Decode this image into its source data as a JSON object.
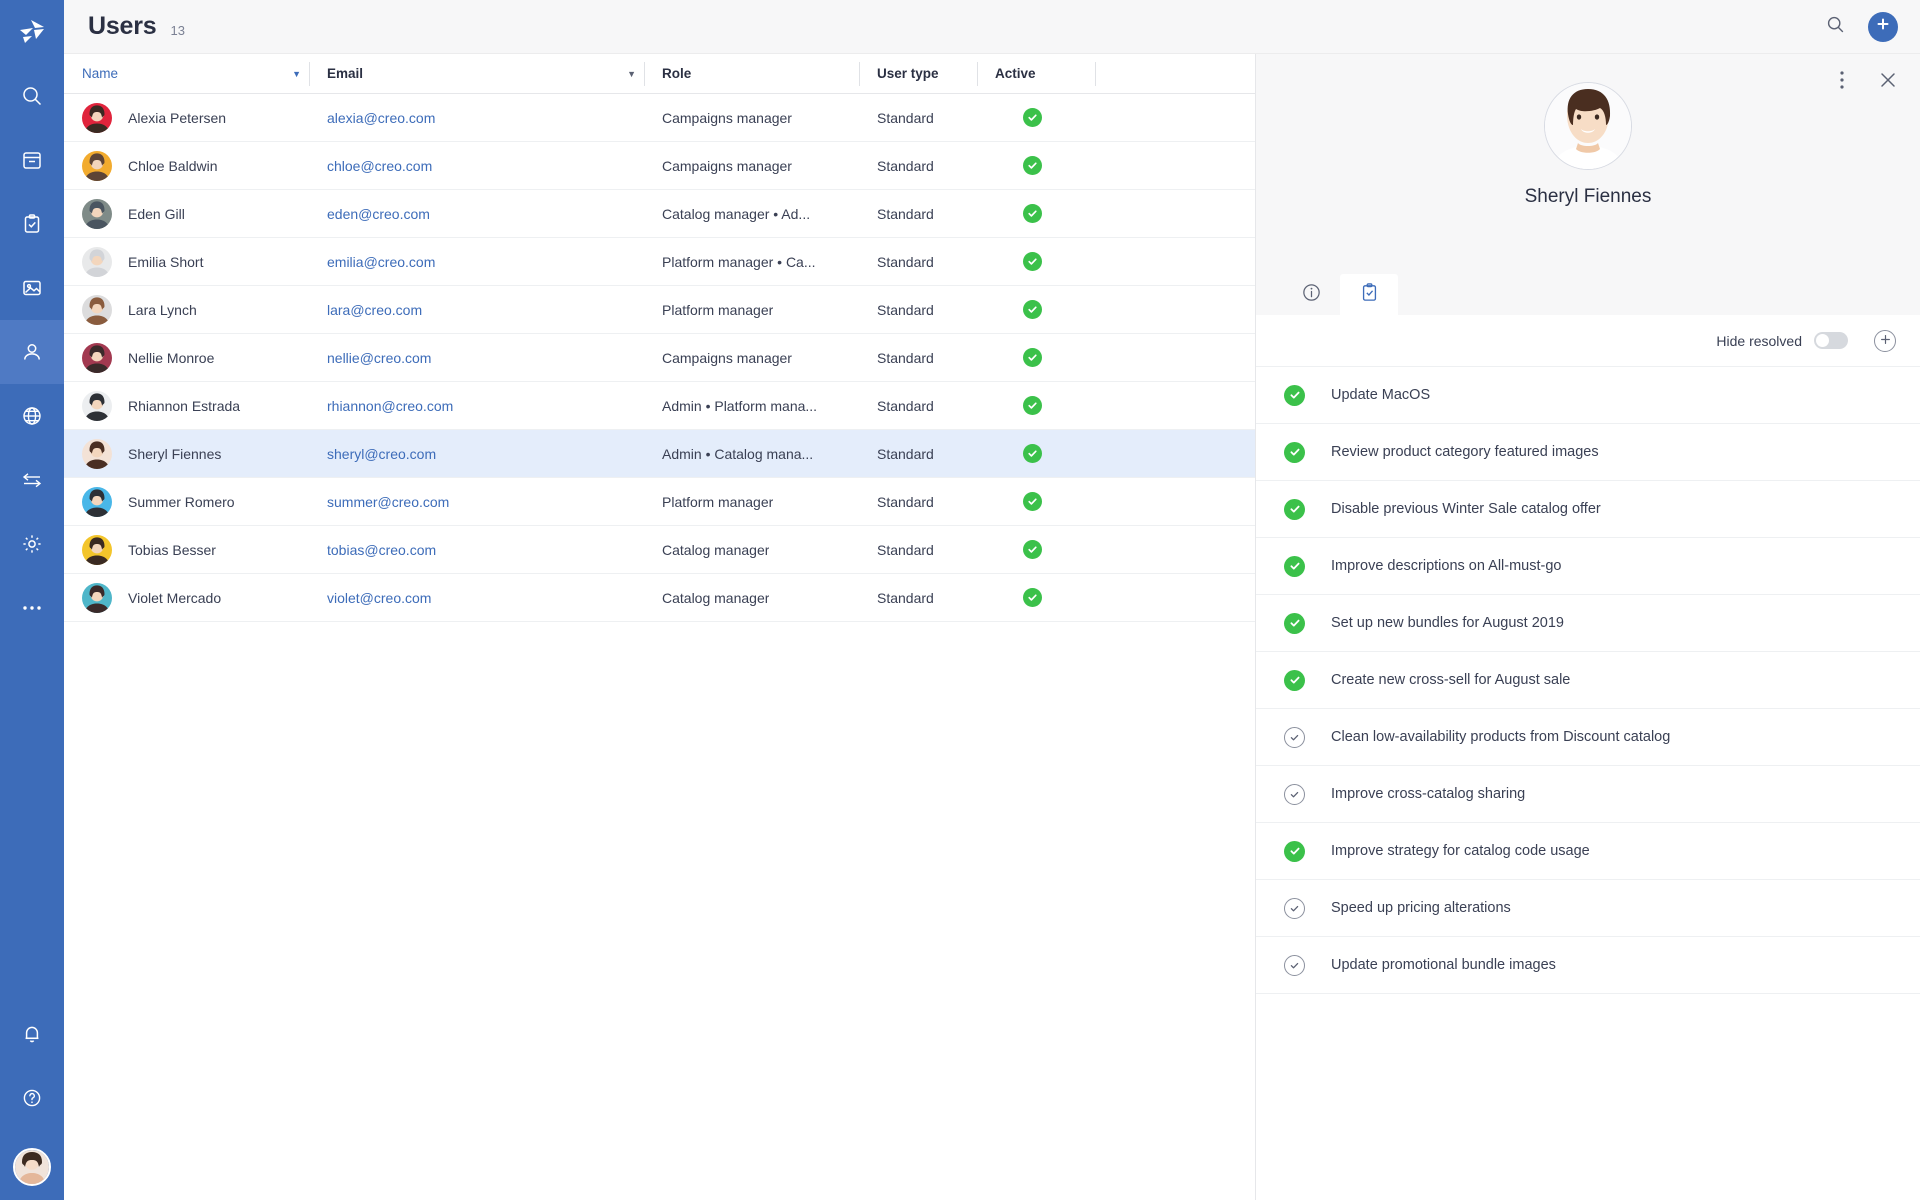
{
  "sidebar": {
    "logo_name": "creo-logo",
    "items": [
      {
        "name": "search-icon",
        "label": "Search",
        "active": false
      },
      {
        "name": "box-icon",
        "label": "Products",
        "active": false
      },
      {
        "name": "clipboard-check-icon",
        "label": "Tasks",
        "active": false
      },
      {
        "name": "image-icon",
        "label": "Media",
        "active": false
      },
      {
        "name": "user-icon",
        "label": "Users",
        "active": true
      },
      {
        "name": "globe-icon",
        "label": "Channels",
        "active": false
      },
      {
        "name": "transfer-arrows-icon",
        "label": "Imports",
        "active": false
      },
      {
        "name": "gear-icon",
        "label": "Settings",
        "active": false
      },
      {
        "name": "more-horizontal-icon",
        "label": "More",
        "active": false
      }
    ],
    "bottom_items": [
      {
        "name": "bell-icon",
        "label": "Notifications"
      },
      {
        "name": "help-circle-icon",
        "label": "Help"
      }
    ],
    "account_avatar_name": "account-avatar"
  },
  "header": {
    "title": "Users",
    "count": "13",
    "search_icon": "search-icon",
    "add_icon": "plus-icon"
  },
  "table": {
    "columns": [
      {
        "label": "Name",
        "sorted": true,
        "has_caret": true
      },
      {
        "label": "Email",
        "sorted": false,
        "has_caret": true
      },
      {
        "label": "Role",
        "sorted": false,
        "has_caret": false
      },
      {
        "label": "User type",
        "sorted": false,
        "has_caret": false
      },
      {
        "label": "Active",
        "sorted": false,
        "has_caret": false
      },
      {
        "label": "",
        "sorted": false,
        "has_caret": false
      }
    ],
    "rows": [
      {
        "name": "Alexia Petersen",
        "email": "alexia@creo.com",
        "role": "Campaigns manager",
        "user_type": "Standard",
        "active": true,
        "selected": false,
        "av1": "#e0243c",
        "av2": "#3a2a22"
      },
      {
        "name": "Chloe Baldwin",
        "email": "chloe@creo.com",
        "role": "Campaigns manager",
        "user_type": "Standard",
        "active": true,
        "selected": false,
        "av1": "#f2ab2e",
        "av2": "#5d4436"
      },
      {
        "name": "Eden Gill",
        "email": "eden@creo.com",
        "role": "Catalog manager • Ad...",
        "user_type": "Standard",
        "active": true,
        "selected": false,
        "av1": "#7f8b88",
        "av2": "#4a5560"
      },
      {
        "name": "Emilia Short",
        "email": "emilia@creo.com",
        "role": "Platform manager • Ca...",
        "user_type": "Standard",
        "active": true,
        "selected": false,
        "av1": "#e8e9ea",
        "av2": "#d2d4d8"
      },
      {
        "name": "Lara Lynch",
        "email": "lara@creo.com",
        "role": "Platform manager",
        "user_type": "Standard",
        "active": true,
        "selected": false,
        "av1": "#dcdcdd",
        "av2": "#8a5c3e"
      },
      {
        "name": "Nellie Monroe",
        "email": "nellie@creo.com",
        "role": "Campaigns manager",
        "user_type": "Standard",
        "active": true,
        "selected": false,
        "av1": "#a23950",
        "av2": "#3a2a2a"
      },
      {
        "name": "Rhiannon Estrada",
        "email": "rhiannon@creo.com",
        "role": "Admin • Platform mana...",
        "user_type": "Standard",
        "active": true,
        "selected": false,
        "av1": "#eceef0",
        "av2": "#2d3036"
      },
      {
        "name": "Sheryl Fiennes",
        "email": "sheryl@creo.com",
        "role": "Admin • Catalog mana...",
        "user_type": "Standard",
        "active": true,
        "selected": true,
        "av1": "#f3e2d6",
        "av2": "#4a2e22"
      },
      {
        "name": "Summer Romero",
        "email": "summer@creo.com",
        "role": "Platform manager",
        "user_type": "Standard",
        "active": true,
        "selected": false,
        "av1": "#49b7e8",
        "av2": "#2d3036"
      },
      {
        "name": "Tobias Besser",
        "email": "tobias@creo.com",
        "role": "Catalog manager",
        "user_type": "Standard",
        "active": true,
        "selected": false,
        "av1": "#f3c52b",
        "av2": "#3a2a22"
      },
      {
        "name": "Violet Mercado",
        "email": "violet@creo.com",
        "role": "Catalog manager",
        "user_type": "Standard",
        "active": true,
        "selected": false,
        "av1": "#4fb6c9",
        "av2": "#3a2a2a"
      }
    ]
  },
  "detail": {
    "kebab_icon": "more-vertical-icon",
    "close_icon": "close-icon",
    "avatar_name": "detail-avatar",
    "user_name": "Sheryl Fiennes",
    "tabs": [
      {
        "name": "tab-info",
        "icon": "info-circle-icon",
        "active": false
      },
      {
        "name": "tab-tasks",
        "icon": "clipboard-check-icon",
        "active": true
      }
    ],
    "toolbar": {
      "hide_resolved_label": "Hide resolved",
      "hide_resolved_on": false,
      "add_icon": "plus-icon"
    },
    "tasks": [
      {
        "label": "Update MacOS",
        "resolved": true
      },
      {
        "label": "Review product category featured images",
        "resolved": true
      },
      {
        "label": "Disable previous Winter Sale catalog offer",
        "resolved": true
      },
      {
        "label": "Improve descriptions on All-must-go",
        "resolved": true
      },
      {
        "label": "Set up new bundles for August 2019",
        "resolved": true
      },
      {
        "label": "Create new cross-sell for August sale",
        "resolved": true
      },
      {
        "label": "Clean low-availability products from Discount catalog",
        "resolved": false
      },
      {
        "label": "Improve cross-catalog sharing",
        "resolved": false
      },
      {
        "label": "Improve strategy for catalog code usage",
        "resolved": true
      },
      {
        "label": "Speed up pricing alterations",
        "resolved": false
      },
      {
        "label": "Update promotional bundle images",
        "resolved": false
      }
    ]
  },
  "colors": {
    "brand_blue": "#3d6cb9",
    "link_blue": "#3d6cb9",
    "success_green": "#3bc14a",
    "selected_row": "#e4edfb",
    "panel_bg": "#f7f7f8"
  }
}
